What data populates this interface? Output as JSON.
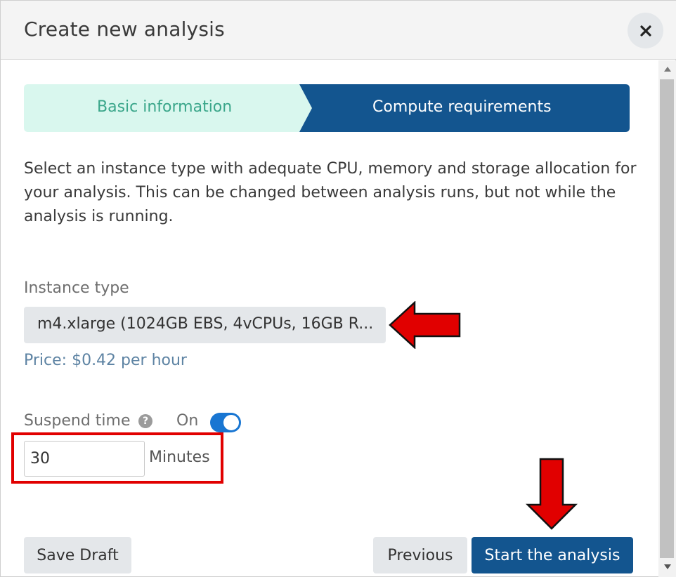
{
  "dialog": {
    "title": "Create new analysis",
    "close_label": "×"
  },
  "steps": [
    {
      "label": "Basic information",
      "state": "completed"
    },
    {
      "label": "Compute requirements",
      "state": "active"
    }
  ],
  "description": {
    "line1": "Select an instance type with adequate CPU, memory and storage allocation for",
    "line2": "your analysis. This can be changed between analysis runs, but not while the analysis is running."
  },
  "instance_type": {
    "label": "Instance type",
    "selected": "m4.xlarge (1024GB EBS, 4vCPUs, 16GB R...",
    "price": "Price: $0.42 per hour"
  },
  "suspend": {
    "label": "Suspend time",
    "toggle_label": "On",
    "toggle_on": true,
    "value": "30",
    "unit": "Minutes"
  },
  "buttons": {
    "save_draft": "Save Draft",
    "previous": "Previous",
    "start": "Start the analysis"
  },
  "colors": {
    "step_completed_bg": "#d9f7ee",
    "step_completed_text": "#3aa68a",
    "step_active_bg": "#13558f",
    "step_active_text": "#ffffff",
    "primary": "#13558f",
    "toggle": "#1976d2",
    "annotation_red": "#e10000"
  }
}
